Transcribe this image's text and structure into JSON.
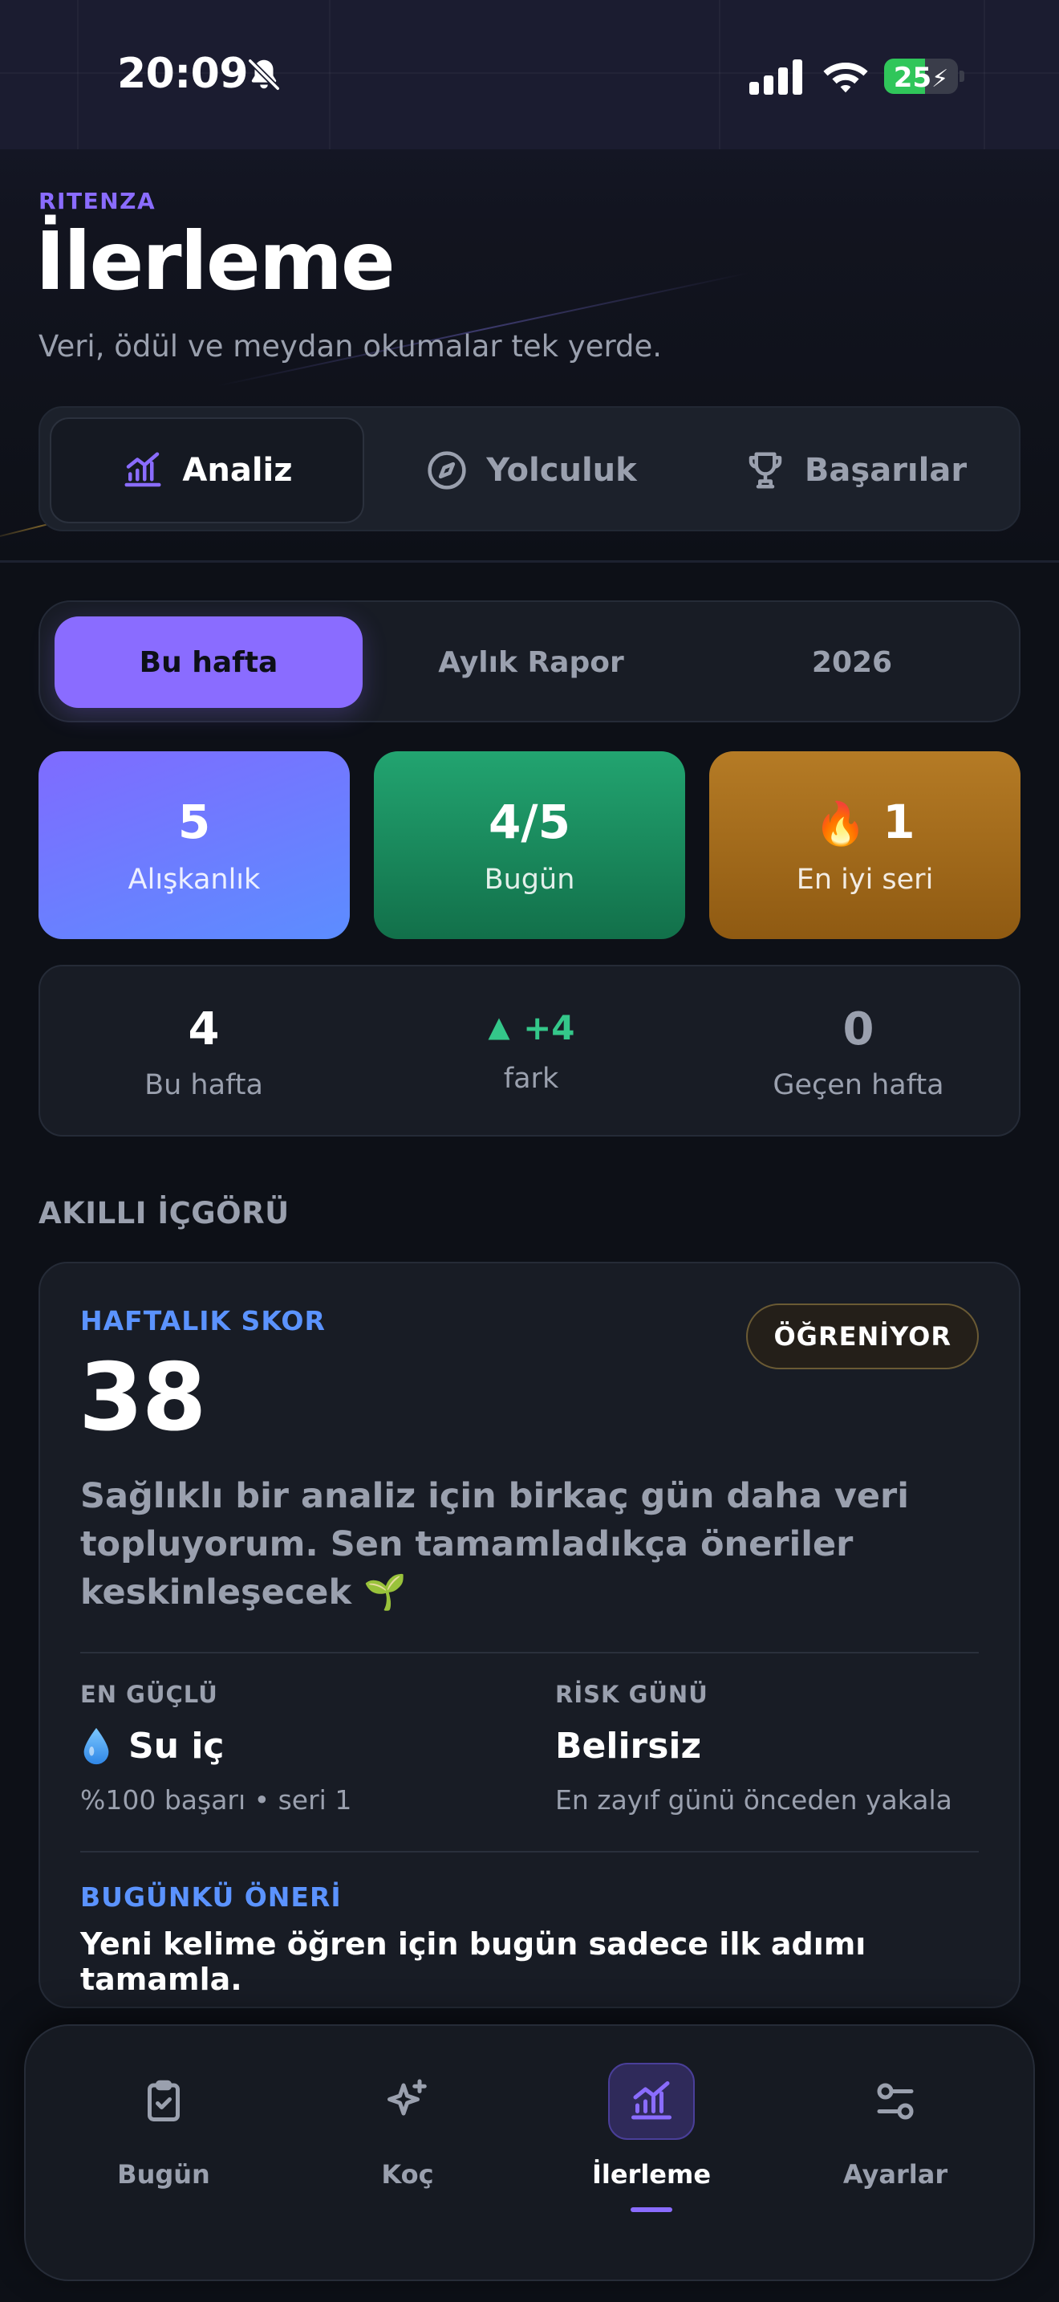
{
  "status_bar": {
    "time": "20:09",
    "battery_level": "25",
    "battery_fraction": 0.25,
    "icons": [
      "bell-slash-icon",
      "cellular-signal-icon",
      "wifi-icon",
      "battery-charging-icon"
    ]
  },
  "header": {
    "brand": "RITENZA",
    "title": "İlerleme",
    "subtitle": "Veri, ödül ve meydan okumalar tek yerde."
  },
  "main_tabs": [
    {
      "label": "Analiz",
      "icon": "chart-bars-trend-icon",
      "active": true
    },
    {
      "label": "Yolculuk",
      "icon": "compass-icon",
      "active": false
    },
    {
      "label": "Başarılar",
      "icon": "trophy-icon",
      "active": false
    }
  ],
  "period_tabs": [
    {
      "label": "Bu hafta",
      "active": true
    },
    {
      "label": "Aylık Rapor",
      "active": false
    },
    {
      "label": "2026",
      "active": false
    }
  ],
  "stats": {
    "habits": {
      "value": "5",
      "label": "Alışkanlık"
    },
    "today": {
      "value": "4/5",
      "label": "Bugün"
    },
    "streak": {
      "value": "1",
      "label": "En iyi seri",
      "emoji": "🔥"
    }
  },
  "week_compare": {
    "this_week": {
      "value": "4",
      "label": "Bu hafta"
    },
    "diff": {
      "value": "+4",
      "label": "fark"
    },
    "last_week": {
      "value": "0",
      "label": "Geçen hafta"
    }
  },
  "insight": {
    "section_label": "AKILLI İÇGÖRÜ",
    "kicker": "HAFTALIK SKOR",
    "score": "38",
    "badge": "ÖĞRENİYOR",
    "message_line1": "Sağlıklı bir analiz için birkaç gün daha veri",
    "message_line2": "topluyorum. Sen tamamladıkça öneriler",
    "message_line3": "keskinleşecek 🌱",
    "strongest": {
      "kicker": "EN GÜÇLÜ",
      "title": "Su iç",
      "icon": "water-drop-icon",
      "sub": "%100 başarı • seri 1"
    },
    "risk_day": {
      "kicker": "RİSK GÜNÜ",
      "title": "Belirsiz",
      "sub": "En zayıf günü önceden yakala"
    },
    "suggestion": {
      "kicker": "BUGÜNKÜ ÖNERİ",
      "text": "Yeni kelime öğren için bugün sadece ilk adımı tamamla."
    }
  },
  "bottom_nav": [
    {
      "label": "Bugün",
      "icon": "clipboard-check-icon",
      "active": false
    },
    {
      "label": "Koç",
      "icon": "sparkles-icon",
      "active": false
    },
    {
      "label": "İlerleme",
      "icon": "chart-bars-trend-icon",
      "active": true
    },
    {
      "label": "Ayarlar",
      "icon": "sliders-icon",
      "active": false
    }
  ],
  "colors": {
    "accent": "#8a6cff",
    "positive": "#34c78a",
    "info": "#5b93ff",
    "background": "#0d1017"
  }
}
